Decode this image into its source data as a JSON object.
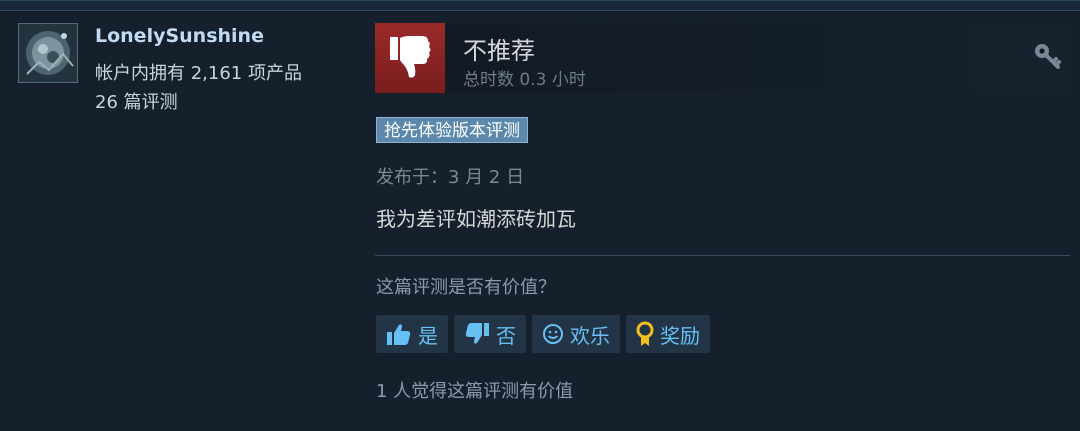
{
  "user": {
    "name": "LonelySunshine",
    "owned_products": "帐户内拥有 2,161 项产品",
    "review_count": "26 篇评测"
  },
  "review": {
    "verdict": "不推荐",
    "hours": "总时数 0.3 小时",
    "badge": "抢先体验版本评测",
    "posted": "发布于：3 月 2 日",
    "content": "我为差评如潮添砖加瓦"
  },
  "helpful": {
    "question": "这篇评测是否有价值？",
    "buttons": {
      "yes": "是",
      "no": "否",
      "funny": "欢乐",
      "award": "奖励"
    },
    "count_text": "1 人觉得这篇评测有价值"
  },
  "icons": {
    "thumb": "thumbs-down-icon",
    "key": "key-icon",
    "yes": "thumbs-up-icon",
    "no": "thumbs-down-icon",
    "funny": "smiley-icon",
    "award": "award-medal-icon"
  },
  "colors": {
    "negative": "#9a2a2a",
    "link": "#66c0f4",
    "badge": "#5c89ab",
    "award": "#f0c020"
  }
}
